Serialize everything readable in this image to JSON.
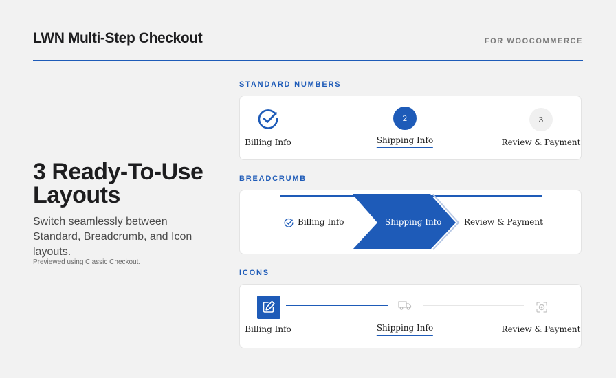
{
  "header": {
    "title": "LWN Multi-Step Checkout",
    "subtitle": "FOR WOOCOMMERCE"
  },
  "hero": {
    "title": "3 Ready-To-Use Layouts",
    "description": "Switch seamlessly between Standard, Breadcrumb, and Icon layouts.",
    "note": "Previewed using Classic Checkout."
  },
  "colors": {
    "accent": "#1e5bb8",
    "background": "#f2f2f2",
    "card": "#ffffff"
  },
  "sections": {
    "standard": {
      "label": "STANDARD NUMBERS",
      "steps": [
        {
          "label": "Billing Info",
          "state": "done",
          "icon": "check-circle-icon"
        },
        {
          "label": "Shipping Info",
          "state": "active",
          "number": "2"
        },
        {
          "label": "Review & Payment",
          "state": "todo",
          "number": "3"
        }
      ]
    },
    "breadcrumb": {
      "label": "BREADCRUMB",
      "steps": [
        {
          "label": "Billing Info",
          "state": "done",
          "icon": "check-circle-icon"
        },
        {
          "label": "Shipping Info",
          "state": "active"
        },
        {
          "label": "Review & Payment",
          "state": "todo"
        }
      ]
    },
    "icons": {
      "label": "ICONS",
      "steps": [
        {
          "label": "Billing Info",
          "state": "done",
          "icon": "edit-icon"
        },
        {
          "label": "Shipping Info",
          "state": "active",
          "icon": "truck-icon"
        },
        {
          "label": "Review & Payment",
          "state": "todo",
          "icon": "payment-icon"
        }
      ]
    }
  }
}
